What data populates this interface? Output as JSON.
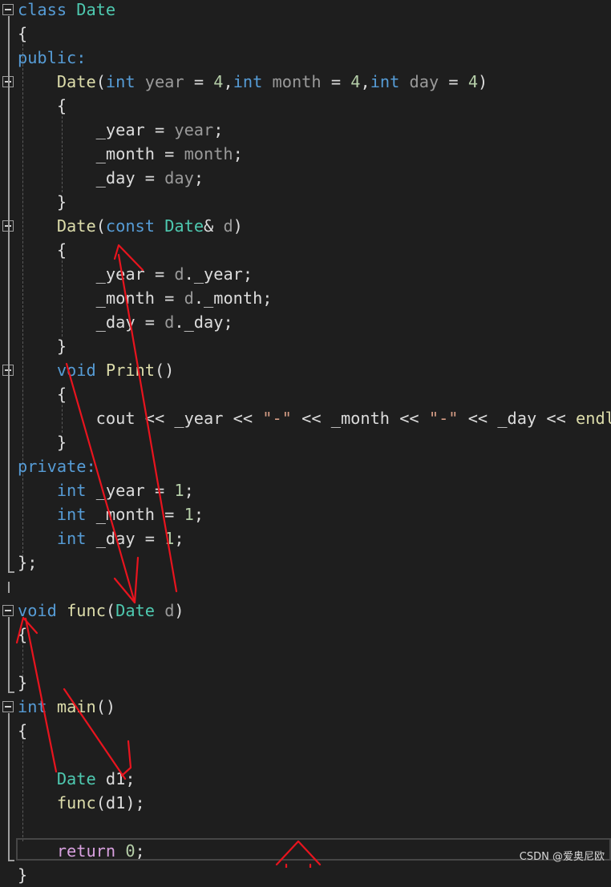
{
  "editor": {
    "background": "#1e1e1e",
    "colors": {
      "kw": "#569cd6",
      "type": "#4ec9b0",
      "fn": "#dcdcaa",
      "var": "#9cdcfe",
      "param": "#9a9a9a",
      "num": "#b5cea8",
      "str": "#d69d85",
      "ctrl": "#d8a0df",
      "plain": "#dcdcdc"
    },
    "lines": [
      [
        {
          "t": "class ",
          "c": "kw"
        },
        {
          "t": "Date",
          "c": "type"
        }
      ],
      [
        {
          "t": "{",
          "c": "plain"
        }
      ],
      [
        {
          "t": "public:",
          "c": "kw"
        }
      ],
      [
        {
          "t": "    ",
          "c": "plain"
        },
        {
          "t": "Date",
          "c": "fn"
        },
        {
          "t": "(",
          "c": "plain"
        },
        {
          "t": "int",
          "c": "kw"
        },
        {
          "t": " ",
          "c": "plain"
        },
        {
          "t": "year",
          "c": "param"
        },
        {
          "t": " = ",
          "c": "plain"
        },
        {
          "t": "4",
          "c": "num"
        },
        {
          "t": ",",
          "c": "plain"
        },
        {
          "t": "int",
          "c": "kw"
        },
        {
          "t": " ",
          "c": "plain"
        },
        {
          "t": "month",
          "c": "param"
        },
        {
          "t": " = ",
          "c": "plain"
        },
        {
          "t": "4",
          "c": "num"
        },
        {
          "t": ",",
          "c": "plain"
        },
        {
          "t": "int",
          "c": "kw"
        },
        {
          "t": " ",
          "c": "plain"
        },
        {
          "t": "day",
          "c": "param"
        },
        {
          "t": " = ",
          "c": "plain"
        },
        {
          "t": "4",
          "c": "num"
        },
        {
          "t": ")",
          "c": "plain"
        }
      ],
      [
        {
          "t": "    {",
          "c": "plain"
        }
      ],
      [
        {
          "t": "        _year",
          "c": "plain"
        },
        {
          "t": " = ",
          "c": "plain"
        },
        {
          "t": "year",
          "c": "param"
        },
        {
          "t": ";",
          "c": "plain"
        }
      ],
      [
        {
          "t": "        _month",
          "c": "plain"
        },
        {
          "t": " = ",
          "c": "plain"
        },
        {
          "t": "month",
          "c": "param"
        },
        {
          "t": ";",
          "c": "plain"
        }
      ],
      [
        {
          "t": "        _day",
          "c": "plain"
        },
        {
          "t": " = ",
          "c": "plain"
        },
        {
          "t": "day",
          "c": "param"
        },
        {
          "t": ";",
          "c": "plain"
        }
      ],
      [
        {
          "t": "    }",
          "c": "plain"
        }
      ],
      [
        {
          "t": "    ",
          "c": "plain"
        },
        {
          "t": "Date",
          "c": "fn"
        },
        {
          "t": "(",
          "c": "plain"
        },
        {
          "t": "const",
          "c": "kw"
        },
        {
          "t": " ",
          "c": "plain"
        },
        {
          "t": "Date",
          "c": "type"
        },
        {
          "t": "& ",
          "c": "plain"
        },
        {
          "t": "d",
          "c": "param"
        },
        {
          "t": ")",
          "c": "plain"
        }
      ],
      [
        {
          "t": "    {",
          "c": "plain"
        }
      ],
      [
        {
          "t": "        _year",
          "c": "plain"
        },
        {
          "t": " = ",
          "c": "plain"
        },
        {
          "t": "d",
          "c": "param"
        },
        {
          "t": "._year;",
          "c": "plain"
        }
      ],
      [
        {
          "t": "        _month",
          "c": "plain"
        },
        {
          "t": " = ",
          "c": "plain"
        },
        {
          "t": "d",
          "c": "param"
        },
        {
          "t": "._month;",
          "c": "plain"
        }
      ],
      [
        {
          "t": "        _day",
          "c": "plain"
        },
        {
          "t": " = ",
          "c": "plain"
        },
        {
          "t": "d",
          "c": "param"
        },
        {
          "t": "._day;",
          "c": "plain"
        }
      ],
      [
        {
          "t": "    }",
          "c": "plain"
        }
      ],
      [
        {
          "t": "    ",
          "c": "plain"
        },
        {
          "t": "void",
          "c": "kw"
        },
        {
          "t": " ",
          "c": "plain"
        },
        {
          "t": "Print",
          "c": "fn"
        },
        {
          "t": "()",
          "c": "plain"
        }
      ],
      [
        {
          "t": "    {",
          "c": "plain"
        }
      ],
      [
        {
          "t": "        cout << _year << ",
          "c": "plain"
        },
        {
          "t": "\"-\"",
          "c": "str"
        },
        {
          "t": " << _month << ",
          "c": "plain"
        },
        {
          "t": "\"-\"",
          "c": "str"
        },
        {
          "t": " << _day << ",
          "c": "plain"
        },
        {
          "t": "endl",
          "c": "fn"
        }
      ],
      [
        {
          "t": "    }",
          "c": "plain"
        }
      ],
      [
        {
          "t": "private:",
          "c": "kw"
        }
      ],
      [
        {
          "t": "    ",
          "c": "plain"
        },
        {
          "t": "int",
          "c": "kw"
        },
        {
          "t": " _year = ",
          "c": "plain"
        },
        {
          "t": "1",
          "c": "num"
        },
        {
          "t": ";",
          "c": "plain"
        }
      ],
      [
        {
          "t": "    ",
          "c": "plain"
        },
        {
          "t": "int",
          "c": "kw"
        },
        {
          "t": " _month = ",
          "c": "plain"
        },
        {
          "t": "1",
          "c": "num"
        },
        {
          "t": ";",
          "c": "plain"
        }
      ],
      [
        {
          "t": "    ",
          "c": "plain"
        },
        {
          "t": "int",
          "c": "kw"
        },
        {
          "t": " _day = ",
          "c": "plain"
        },
        {
          "t": "1",
          "c": "num"
        },
        {
          "t": ";",
          "c": "plain"
        }
      ],
      [
        {
          "t": "};",
          "c": "plain"
        }
      ],
      [],
      [
        {
          "t": "void",
          "c": "kw"
        },
        {
          "t": " ",
          "c": "plain"
        },
        {
          "t": "func",
          "c": "fn"
        },
        {
          "t": "(",
          "c": "plain"
        },
        {
          "t": "Date",
          "c": "type"
        },
        {
          "t": " ",
          "c": "plain"
        },
        {
          "t": "d",
          "c": "param"
        },
        {
          "t": ")",
          "c": "plain"
        }
      ],
      [
        {
          "t": "{",
          "c": "plain"
        }
      ],
      [],
      [
        {
          "t": "}",
          "c": "plain"
        }
      ],
      [
        {
          "t": "int",
          "c": "kw"
        },
        {
          "t": " ",
          "c": "plain"
        },
        {
          "t": "main",
          "c": "fn"
        },
        {
          "t": "()",
          "c": "plain"
        }
      ],
      [
        {
          "t": "{",
          "c": "plain"
        }
      ],
      [],
      [
        {
          "t": "    ",
          "c": "plain"
        },
        {
          "t": "Date",
          "c": "type"
        },
        {
          "t": " d1;",
          "c": "plain"
        }
      ],
      [
        {
          "t": "    ",
          "c": "plain"
        },
        {
          "t": "func",
          "c": "fn"
        },
        {
          "t": "(d1);",
          "c": "plain"
        }
      ],
      [],
      [
        {
          "t": "    ",
          "c": "plain"
        },
        {
          "t": "return",
          "c": "ctrl"
        },
        {
          "t": " ",
          "c": "plain"
        },
        {
          "t": "0",
          "c": "num"
        },
        {
          "t": ";",
          "c": "plain"
        }
      ],
      [
        {
          "t": "}",
          "c": "plain"
        }
      ]
    ]
  },
  "watermark": "CSDN @爱奥尼欧",
  "annotation_color": "#e8141e"
}
